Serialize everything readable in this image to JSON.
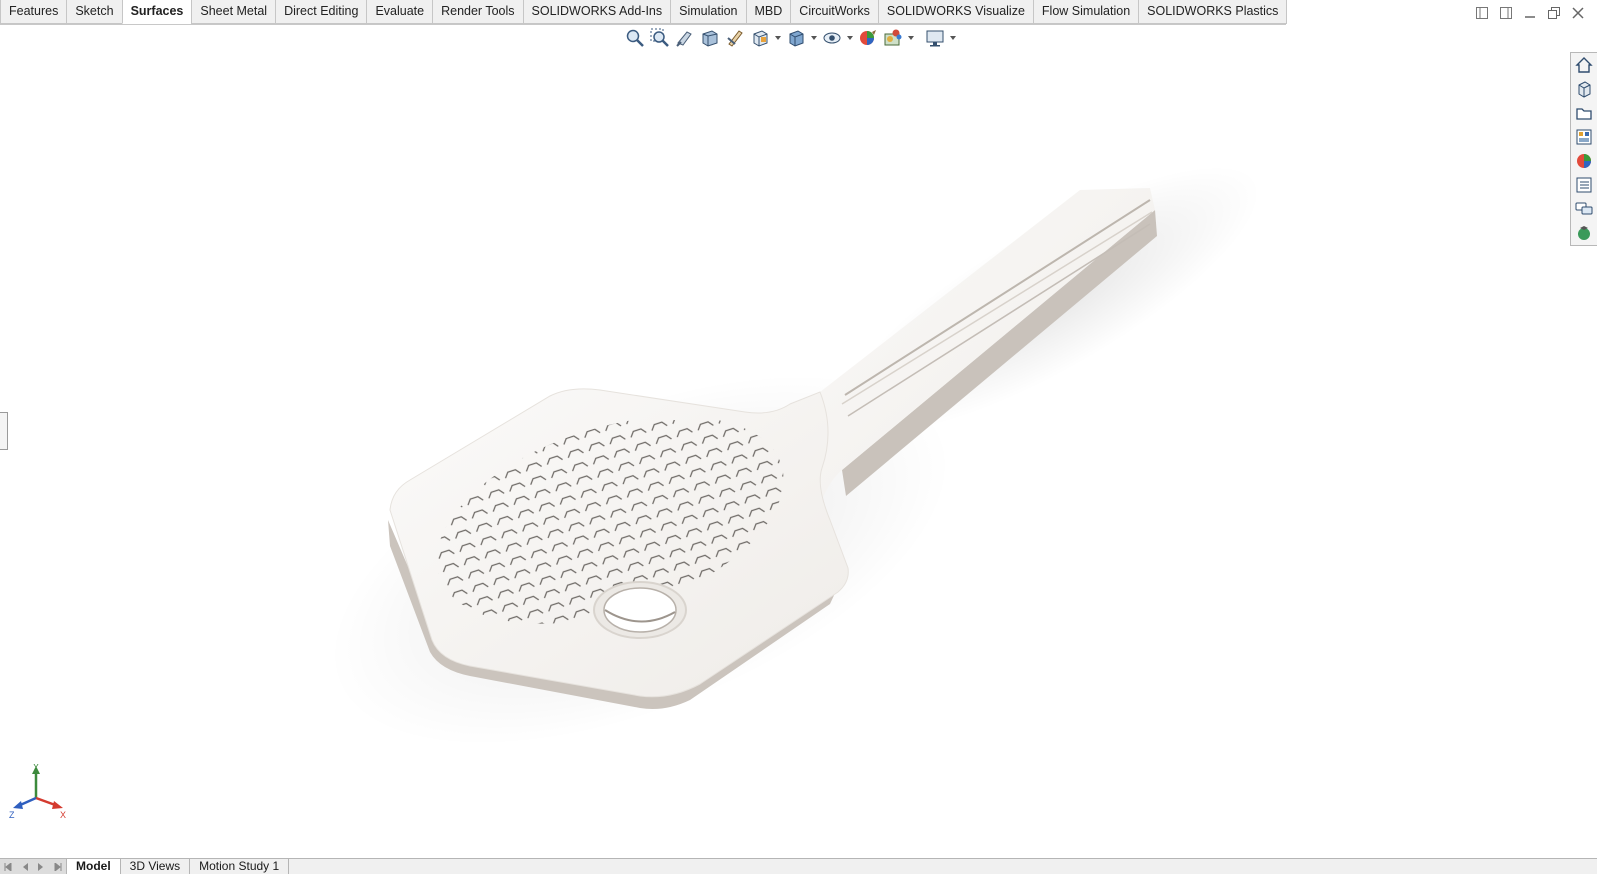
{
  "command_tabs": [
    {
      "label": "Features",
      "active": false
    },
    {
      "label": "Sketch",
      "active": false
    },
    {
      "label": "Surfaces",
      "active": true
    },
    {
      "label": "Sheet Metal",
      "active": false
    },
    {
      "label": "Direct Editing",
      "active": false
    },
    {
      "label": "Evaluate",
      "active": false
    },
    {
      "label": "Render Tools",
      "active": false
    },
    {
      "label": "SOLIDWORKS Add-Ins",
      "active": false
    },
    {
      "label": "Simulation",
      "active": false
    },
    {
      "label": "MBD",
      "active": false
    },
    {
      "label": "CircuitWorks",
      "active": false
    },
    {
      "label": "SOLIDWORKS Visualize",
      "active": false
    },
    {
      "label": "Flow Simulation",
      "active": false
    },
    {
      "label": "SOLIDWORKS Plastics",
      "active": false
    }
  ],
  "heads_up_toolbar": [
    "zoom-to-fit-icon",
    "zoom-to-area-icon",
    "previous-view-icon",
    "section-view-icon",
    "dynamic-annotation-icon",
    "view-orientation-icon",
    "display-style-icon",
    "hide-show-items-icon",
    "edit-appearance-icon",
    "apply-scene-icon",
    "view-settings-icon"
  ],
  "task_pane": [
    "solidworks-resources-icon",
    "design-library-icon",
    "file-explorer-icon",
    "view-palette-icon",
    "appearances-scenes-icon",
    "custom-properties-icon",
    "solidworks-forum-icon",
    "3dexperience-icon"
  ],
  "triad": {
    "x": "X",
    "y": "Y",
    "z": "Z"
  },
  "bottom_tabs": [
    {
      "label": "Model",
      "active": true
    },
    {
      "label": "3D Views",
      "active": false
    },
    {
      "label": "Motion Study 1",
      "active": false
    }
  ],
  "colors": {
    "model": "#f3f1ee",
    "model_edge": "#cfc9c2",
    "x_axis": "#d43a2f",
    "y_axis": "#3c8a3c",
    "z_axis": "#2f5fbf"
  }
}
